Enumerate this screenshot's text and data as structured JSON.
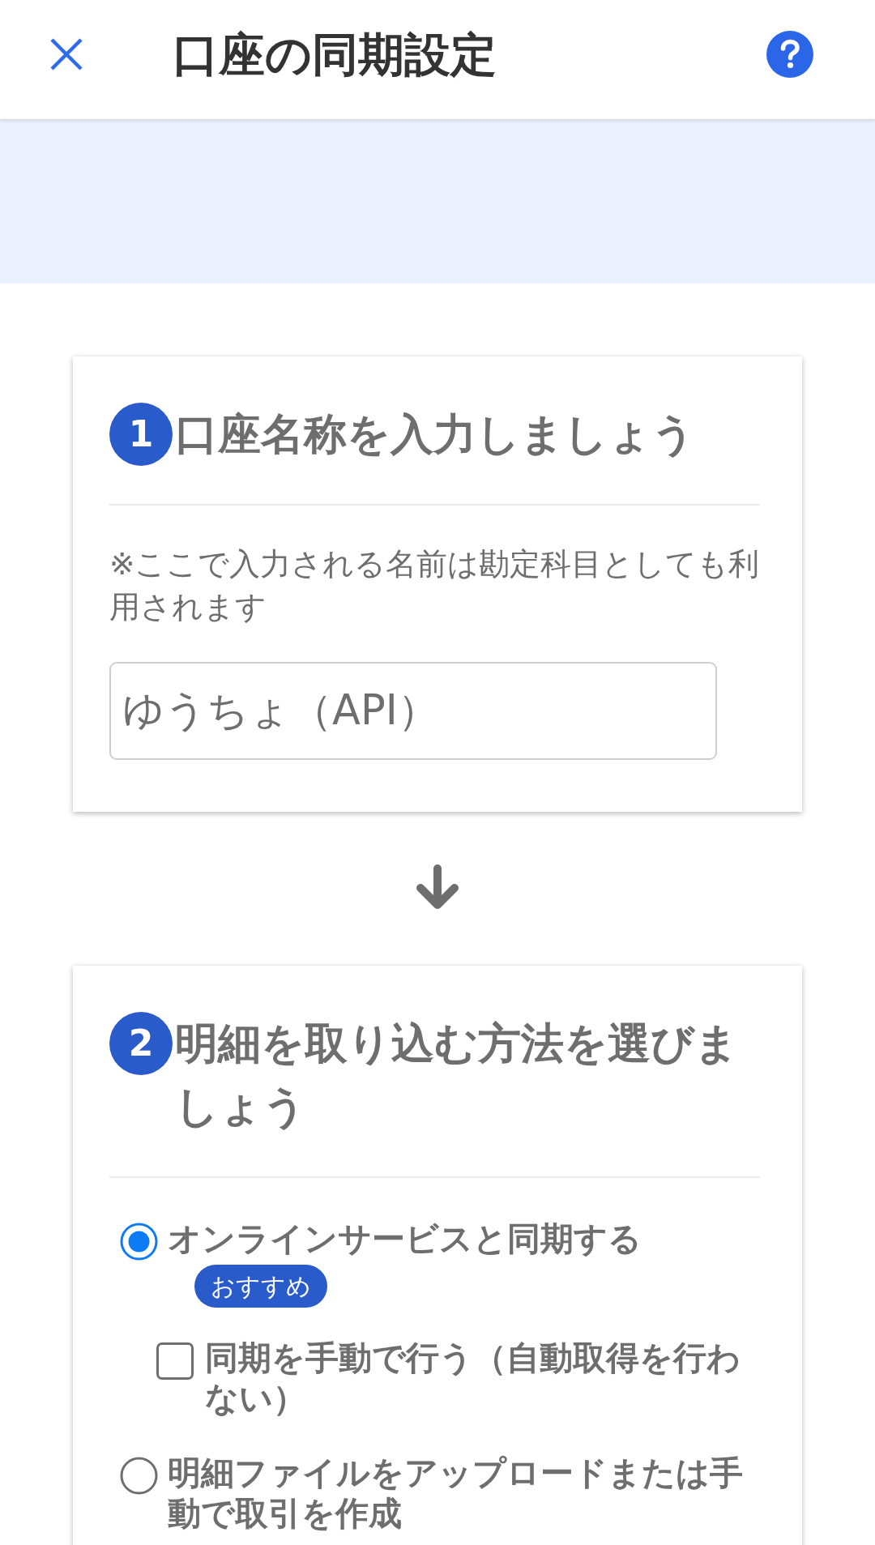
{
  "header": {
    "title": "口座の同期設定"
  },
  "steps": [
    {
      "number": "1",
      "title": "口座名称を入力しましょう",
      "note": "※ここで入力される名前は勘定科目としても利用されます",
      "name_field": {
        "value": "ゆうちょ（API）"
      }
    },
    {
      "number": "2",
      "title": "明細を取り込む方法を選びましょう",
      "options": [
        {
          "kind": "radio",
          "label": "オンラインサービスと同期する",
          "badge": "おすすめ",
          "selected": true,
          "children": [
            {
              "kind": "checkbox",
              "label": "同期を手動で行う（自動取得を行わない）",
              "checked": false
            }
          ]
        },
        {
          "kind": "radio",
          "label": "明細ファイルをアップロードまたは手動で取引を作成",
          "selected": false
        }
      ]
    }
  ]
}
